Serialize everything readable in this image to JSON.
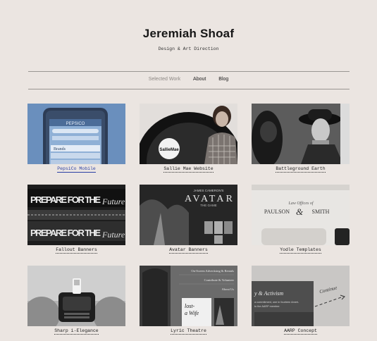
{
  "site": {
    "title": "Jeremiah Shoaf",
    "tagline": "Design & Art Direction"
  },
  "nav": [
    {
      "label": "Selected Work",
      "state": "current"
    },
    {
      "label": "About",
      "state": "link"
    },
    {
      "label": "Blog",
      "state": "link"
    }
  ],
  "colors": {
    "background": "#ebe5e1",
    "active_link": "#2a3fa3",
    "pepsico_tint": "#6a8fbd"
  },
  "portfolio": [
    {
      "caption": "PepsiCo Mobile",
      "active": true
    },
    {
      "caption": "Sallie Mae Website"
    },
    {
      "caption": "Battleground Earth"
    },
    {
      "caption": "Fallout Banners"
    },
    {
      "caption": "Avatar Banners"
    },
    {
      "caption": "Yodle Templates"
    },
    {
      "caption": "Sharp i-Elegance"
    },
    {
      "caption": "Lyric Theatre"
    },
    {
      "caption": "AARP Concept"
    }
  ],
  "thumbs": {
    "pepsico": {
      "brand": "PEPSICO",
      "search": "Search Navigation",
      "section": "Brands"
    },
    "salliemae": {
      "logo": "SallieMae"
    },
    "fallout": {
      "line1": "PREPARE FOR THE",
      "line1_script": "Future",
      "line2": "PREPARE FOR THE",
      "line2_script": "Future"
    },
    "avatar": {
      "small": "JAMES CAMERON'S",
      "title": "AVATAR",
      "subtitle": "THE GAME"
    },
    "yodle": {
      "small": "Law Offices of",
      "name_left": "PAULSON",
      "amp": "&",
      "name_right": "SMITH"
    },
    "lyric": {
      "menu": [
        "On-Screen Advertising & Rentals",
        "Contribute & Volunteer",
        "About Us"
      ],
      "poster_line1": "lost-",
      "poster_line2": "a Wife"
    },
    "aarp": {
      "headline": "y & Activism",
      "body_line1": "a commitment, one in fourteen Ameri-",
      "body_line2": "to the AARP member.",
      "note": "Continue"
    }
  }
}
